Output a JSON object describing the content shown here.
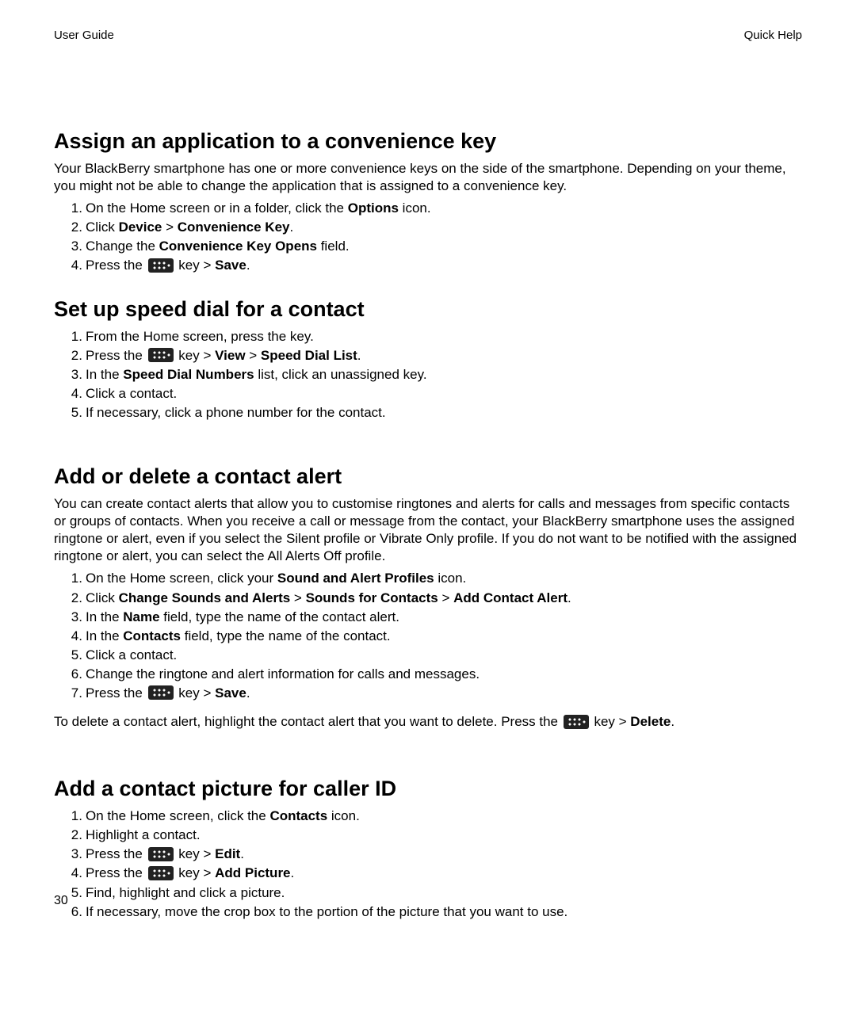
{
  "header": {
    "left": "User Guide",
    "right": "Quick Help"
  },
  "pagenum": "30",
  "sections": [
    {
      "heading": "Assign an application to a convenience key",
      "intro": "Your BlackBerry smartphone has one or more convenience keys on the side of the smartphone. Depending on your theme, you might not be able to change the application that is assigned to a convenience key.",
      "steps": [
        [
          {
            "t": "text",
            "v": "On the Home screen or in a folder, click the "
          },
          {
            "t": "bold",
            "v": "Options"
          },
          {
            "t": "text",
            "v": " icon."
          }
        ],
        [
          {
            "t": "text",
            "v": "Click "
          },
          {
            "t": "bold",
            "v": "Device"
          },
          {
            "t": "text",
            "v": " > "
          },
          {
            "t": "bold",
            "v": "Convenience Key"
          },
          {
            "t": "text",
            "v": "."
          }
        ],
        [
          {
            "t": "text",
            "v": "Change the "
          },
          {
            "t": "bold",
            "v": "Convenience Key Opens"
          },
          {
            "t": "text",
            "v": " field."
          }
        ],
        [
          {
            "t": "text",
            "v": "Press the "
          },
          {
            "t": "icon",
            "name": "blackberry-menu-icon"
          },
          {
            "t": "text",
            "v": " key > "
          },
          {
            "t": "bold",
            "v": "Save"
          },
          {
            "t": "text",
            "v": "."
          }
        ]
      ]
    },
    {
      "heading": "Set up speed dial for a contact",
      "steps": [
        [
          {
            "t": "text",
            "v": "From the Home screen, press the key."
          }
        ],
        [
          {
            "t": "text",
            "v": "Press the "
          },
          {
            "t": "icon",
            "name": "blackberry-menu-icon"
          },
          {
            "t": "text",
            "v": " key > "
          },
          {
            "t": "bold",
            "v": "View"
          },
          {
            "t": "text",
            "v": " > "
          },
          {
            "t": "bold",
            "v": "Speed Dial List"
          },
          {
            "t": "text",
            "v": "."
          }
        ],
        [
          {
            "t": "text",
            "v": "In the "
          },
          {
            "t": "bold",
            "v": "Speed Dial Numbers"
          },
          {
            "t": "text",
            "v": " list, click an unassigned key."
          }
        ],
        [
          {
            "t": "text",
            "v": "Click a contact."
          }
        ],
        [
          {
            "t": "text",
            "v": "If necessary, click a phone number for the contact."
          }
        ]
      ]
    },
    {
      "heading": "Add or delete a contact alert",
      "intro": "You can create contact alerts that allow you to customise ringtones and alerts for calls and messages from specific contacts or groups of contacts. When you receive a call or message from the contact, your BlackBerry smartphone uses the assigned ringtone or alert, even if you select the Silent profile or Vibrate Only profile. If you do not want to be notified with the assigned ringtone or alert, you can select the All Alerts Off profile.",
      "steps": [
        [
          {
            "t": "text",
            "v": "On the Home screen, click your "
          },
          {
            "t": "bold",
            "v": "Sound and Alert Profiles"
          },
          {
            "t": "text",
            "v": " icon."
          }
        ],
        [
          {
            "t": "text",
            "v": "Click "
          },
          {
            "t": "bold",
            "v": "Change Sounds and Alerts"
          },
          {
            "t": "text",
            "v": " > "
          },
          {
            "t": "bold",
            "v": "Sounds for Contacts"
          },
          {
            "t": "text",
            "v": " > "
          },
          {
            "t": "bold",
            "v": "Add Contact Alert"
          },
          {
            "t": "text",
            "v": "."
          }
        ],
        [
          {
            "t": "text",
            "v": "In the "
          },
          {
            "t": "bold",
            "v": "Name"
          },
          {
            "t": "text",
            "v": " field, type the name of the contact alert."
          }
        ],
        [
          {
            "t": "text",
            "v": "In the "
          },
          {
            "t": "bold",
            "v": "Contacts"
          },
          {
            "t": "text",
            "v": " field, type the name of the contact."
          }
        ],
        [
          {
            "t": "text",
            "v": "Click a contact."
          }
        ],
        [
          {
            "t": "text",
            "v": "Change the ringtone and alert information for calls and messages."
          }
        ],
        [
          {
            "t": "text",
            "v": "Press the "
          },
          {
            "t": "icon",
            "name": "blackberry-menu-icon"
          },
          {
            "t": "text",
            "v": " key > "
          },
          {
            "t": "bold",
            "v": "Save"
          },
          {
            "t": "text",
            "v": "."
          }
        ]
      ],
      "afternote": [
        {
          "t": "text",
          "v": "To delete a contact alert, highlight the contact alert that you want to delete. Press the "
        },
        {
          "t": "icon",
          "name": "blackberry-menu-icon"
        },
        {
          "t": "text",
          "v": " key > "
        },
        {
          "t": "bold",
          "v": "Delete"
        },
        {
          "t": "text",
          "v": "."
        }
      ]
    },
    {
      "heading": "Add a contact picture for caller ID",
      "steps": [
        [
          {
            "t": "text",
            "v": "On the Home screen, click the "
          },
          {
            "t": "bold",
            "v": "Contacts"
          },
          {
            "t": "text",
            "v": " icon."
          }
        ],
        [
          {
            "t": "text",
            "v": "Highlight a contact."
          }
        ],
        [
          {
            "t": "text",
            "v": "Press the "
          },
          {
            "t": "icon",
            "name": "blackberry-menu-icon"
          },
          {
            "t": "text",
            "v": " key > "
          },
          {
            "t": "bold",
            "v": "Edit"
          },
          {
            "t": "text",
            "v": "."
          }
        ],
        [
          {
            "t": "text",
            "v": "Press the "
          },
          {
            "t": "icon",
            "name": "blackberry-menu-icon"
          },
          {
            "t": "text",
            "v": " key > "
          },
          {
            "t": "bold",
            "v": "Add Picture"
          },
          {
            "t": "text",
            "v": "."
          }
        ],
        [
          {
            "t": "text",
            "v": "Find, highlight and click a picture."
          }
        ],
        [
          {
            "t": "text",
            "v": "If necessary, move the crop box to the portion of the picture that you want to use."
          }
        ]
      ]
    }
  ]
}
